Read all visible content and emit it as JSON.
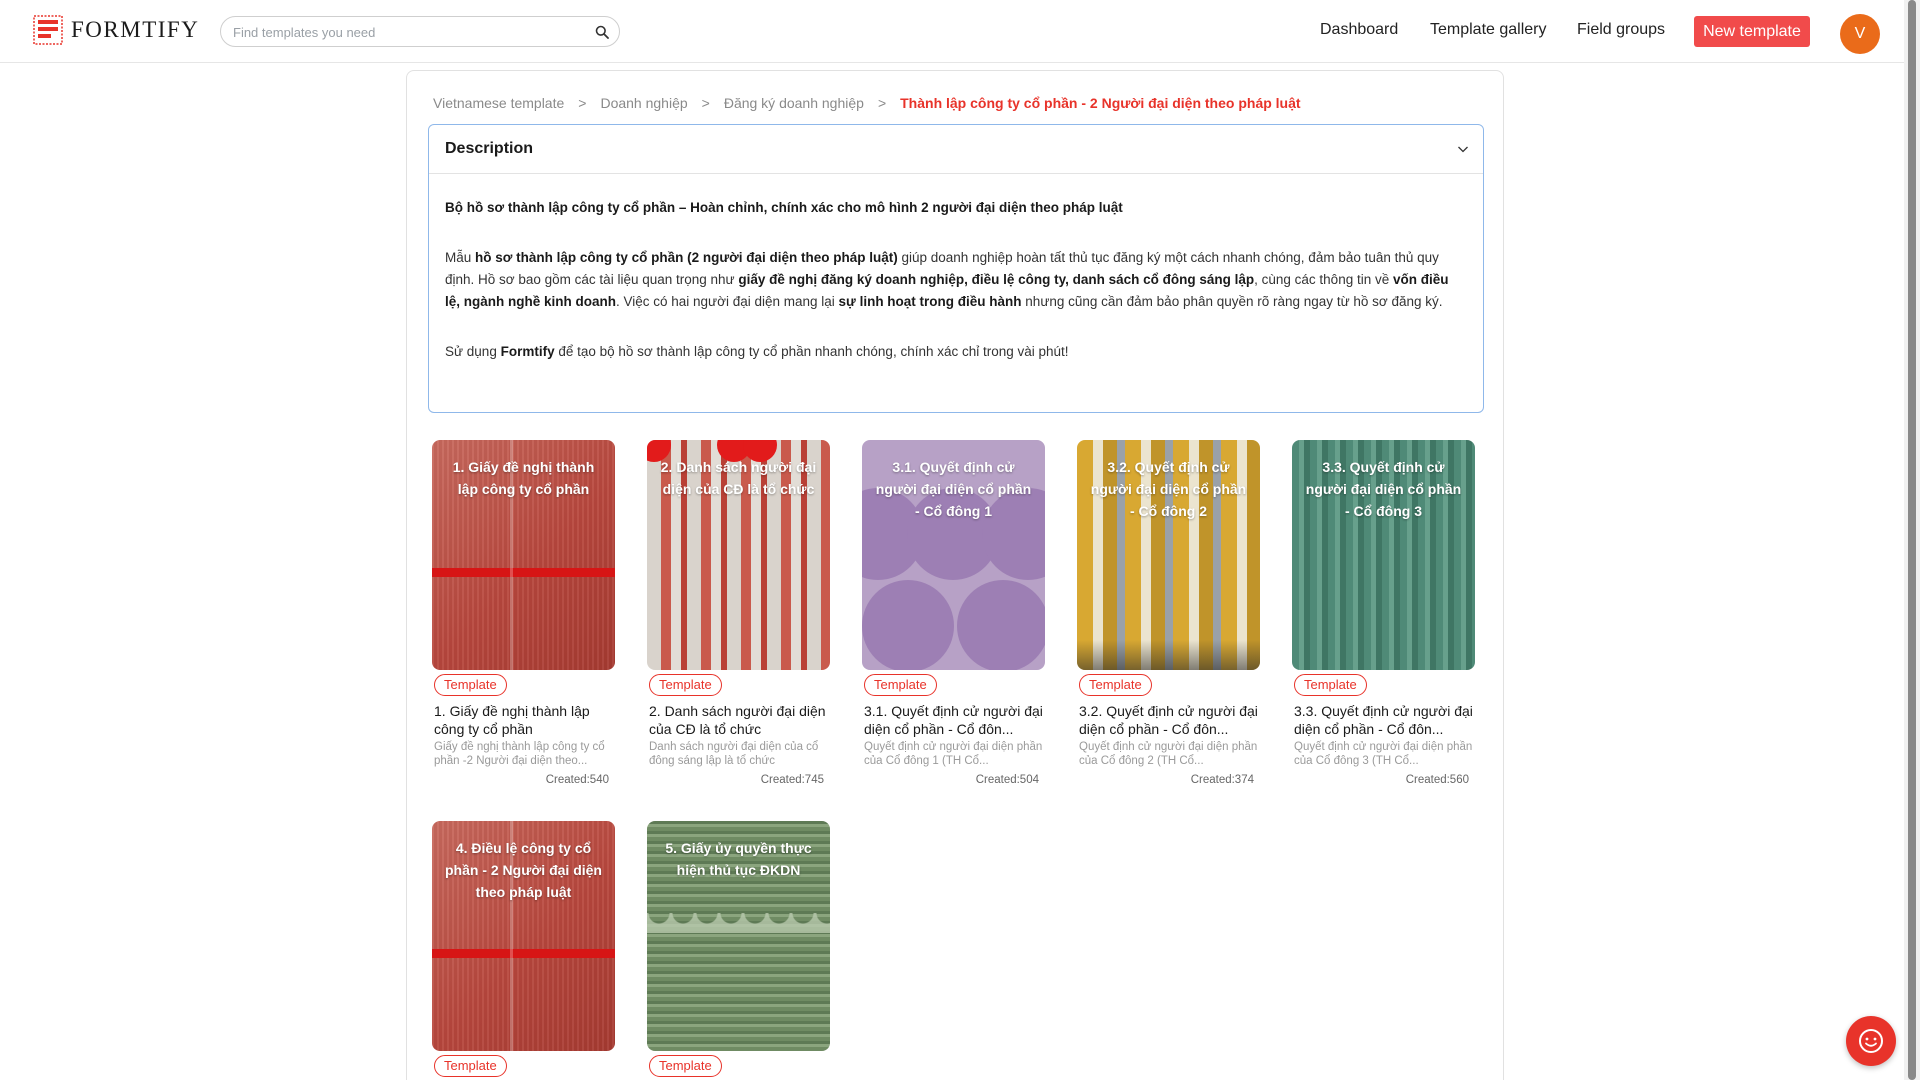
{
  "header": {
    "logo_text": "FORMTIFY",
    "search_placeholder": "Find templates you need",
    "nav": {
      "dashboard": "Dashboard",
      "gallery": "Template gallery",
      "field_groups": "Field groups"
    },
    "new_template": "New template",
    "avatar_letter": "V",
    "colors": {
      "accent": "#f14b4b",
      "avatar": "#ea6b1a"
    }
  },
  "breadcrumb": {
    "items": [
      "Vietnamese template",
      "Doanh nghiệp",
      "Đăng ký doanh nghiệp"
    ],
    "separator": ">",
    "current": "Thành lập công ty cổ phần - 2 Người đại diện theo pháp luật"
  },
  "description": {
    "title": "Description",
    "headline": "Bộ hồ sơ thành lập công ty cổ phần – Hoàn chỉnh, chính xác cho mô hình 2 người đại diện theo pháp luật",
    "p2": {
      "t1": "Mẫu ",
      "b1": "hồ sơ thành lập công ty cổ phần (2 người đại diện theo pháp luật)",
      "t2": " giúp doanh nghiệp hoàn tất thủ tục đăng ký một cách nhanh chóng, đảm bảo tuân thủ quy định. Hồ sơ bao gồm các tài liệu quan trọng như ",
      "b2": "giấy đề nghị đăng ký doanh nghiệp, điều lệ công ty, danh sách cổ đông sáng lập",
      "t3": ", cùng các thông tin về ",
      "b3": "vốn điều lệ, ngành nghề kinh doanh",
      "t4": ". Việc có hai người đại diện mang lại ",
      "b4": "sự linh hoạt trong điều hành",
      "t5": " nhưng cũng cần đảm bảo phân quyền rõ ràng ngay từ hồ sơ đăng ký."
    },
    "p3": {
      "t1": "Sử dụng ",
      "b1": "Formtify",
      "t2": " để tạo bộ hồ sơ thành lập công ty cổ phần nhanh chóng, chính xác chỉ trong vài phút!"
    }
  },
  "cards": [
    {
      "thumb_title": "1. Giấy đề nghị thành lập công ty cổ phần",
      "badge": "Template",
      "name": "1. Giấy đề nghị thành lập công ty cổ phần",
      "desc": "Giấy đề nghị thành lập công ty cổ phần -2 Người đại diện theo...",
      "created": "Created:540"
    },
    {
      "thumb_title": "2. Danh sách người đại diện của CĐ là tổ chức",
      "badge": "Template",
      "name": "2. Danh sách người đại diện của CĐ là tổ chức",
      "desc": "Danh sách người đại diện của cổ đông sáng lập là tổ chức",
      "created": "Created:745"
    },
    {
      "thumb_title": "3.1. Quyết định cử người đại diện cổ phần - Cổ đông 1",
      "badge": "Template",
      "name": "3.1. Quyết định cử người đại diện cổ phần - Cổ đôn...",
      "desc": "Quyết định cử người đại diện phần của Cổ đông 1 (TH Cổ...",
      "created": "Created:504"
    },
    {
      "thumb_title": "3.2. Quyết định cử người đại diện cổ phần - Cổ đông 2",
      "badge": "Template",
      "name": "3.2. Quyết định cử người đại diện cổ phần - Cổ đôn...",
      "desc": "Quyết định cử người đại diện phần của Cổ đông 2 (TH Cổ...",
      "created": "Created:374"
    },
    {
      "thumb_title": "3.3. Quyết định cử người đại diện cổ phần - Cổ đông 3",
      "badge": "Template",
      "name": "3.3. Quyết định cử người đại diện cổ phần - Cổ đôn...",
      "desc": "Quyết định cử người đại diện phần của Cổ đông 3 (TH Cổ...",
      "created": "Created:560"
    },
    {
      "thumb_title": "4. Điều lệ công ty cổ phần - 2 Người đại diện theo pháp luật",
      "badge": "Template"
    },
    {
      "thumb_title": "5. Giấy ủy quyền thực hiện thủ tục ĐKDN",
      "badge": "Template"
    }
  ],
  "icons": {
    "logo": "formtify-logo-icon",
    "search": "search-icon",
    "chevron": "chevron-down-icon",
    "chat": "chat-smile-icon"
  }
}
